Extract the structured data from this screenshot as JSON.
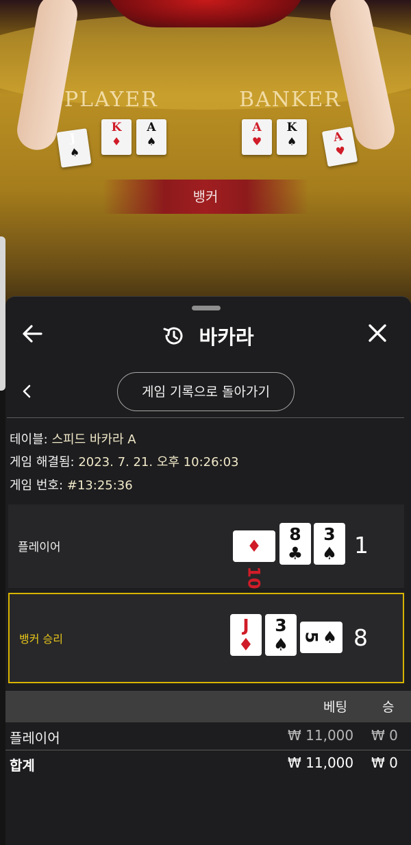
{
  "table_view": {
    "player_word": "PLAYER",
    "banker_word": "BANKER",
    "result_banner": "뱅커",
    "player_cards": [
      {
        "rank": "J",
        "suit": "♠",
        "color": "#111111"
      },
      {
        "rank": "K",
        "suit": "♦",
        "color": "#d01c28"
      },
      {
        "rank": "A",
        "suit": "♠",
        "color": "#111111"
      }
    ],
    "banker_cards": [
      {
        "rank": "A",
        "suit": "♥",
        "color": "#d01c28"
      },
      {
        "rank": "K",
        "suit": "♠",
        "color": "#111111"
      },
      {
        "rank": "A",
        "suit": "♥",
        "color": "#d01c28"
      }
    ]
  },
  "header": {
    "back_icon": "arrow-left-icon",
    "history_icon": "history-icon",
    "title": "바카라",
    "close_icon": "close-icon"
  },
  "nav": {
    "sub_back_icon": "chevron-left-icon",
    "history_button": "게임 기록으로 돌아가기"
  },
  "details": {
    "table_label": "테이블:",
    "table_value": "스피드 바카라 A",
    "resolved_label": "게임 해결됨:",
    "resolved_value": "2023. 7. 21. 오후 10:26:03",
    "game_no_label": "게임 번호:",
    "game_no_value": "#13:25:36"
  },
  "hands": {
    "player": {
      "label": "플레이어",
      "total": "1",
      "cards": [
        {
          "rank": "10",
          "suit": "♦",
          "color": "#d01c28",
          "sideways": true
        },
        {
          "rank": "8",
          "suit": "♣",
          "color": "#111111",
          "sideways": false
        },
        {
          "rank": "3",
          "suit": "♠",
          "color": "#111111",
          "sideways": false
        }
      ]
    },
    "banker": {
      "label": "뱅커 승리",
      "total": "8",
      "cards": [
        {
          "rank": "J",
          "suit": "♦",
          "color": "#d01c28",
          "sideways": false
        },
        {
          "rank": "3",
          "suit": "♠",
          "color": "#111111",
          "sideways": false
        },
        {
          "rank": "5",
          "suit": "♠",
          "color": "#111111",
          "sideways": true
        }
      ]
    }
  },
  "bets": {
    "col_bet": "베팅",
    "col_win": "승",
    "rows": [
      {
        "label": "플레이어",
        "bet": "₩ 11,000",
        "win": "₩ 0"
      }
    ],
    "total": {
      "label": "합계",
      "bet": "₩ 11,000",
      "win": "₩ 0"
    }
  },
  "colors": {
    "highlight_border": "#d8b400",
    "winner_label": "#e8c619",
    "card_red": "#d01c28"
  }
}
